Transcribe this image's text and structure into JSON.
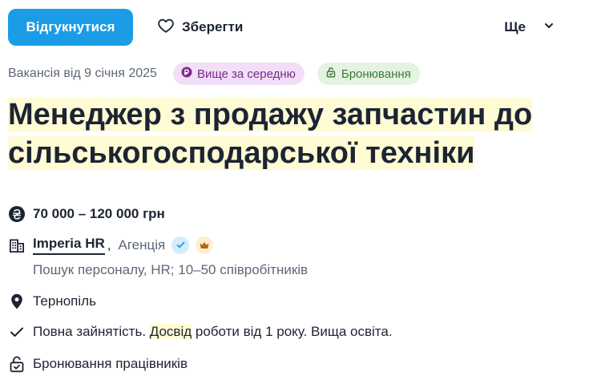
{
  "actions": {
    "apply_label": "Відгукнутися",
    "save_label": "Зберегти",
    "more_label": "Ще"
  },
  "meta": {
    "date": "Вакансія від 9 січня 2025",
    "badge_salary": "Вище за середню",
    "badge_reserve": "Бронювання"
  },
  "vacancy": {
    "title_line1": "Менеджер з продажу запчастин до",
    "title_line2": "сільськогосподарської техніки"
  },
  "details": {
    "salary": "70 000 – 120 000 грн",
    "company_name": "Imperia HR",
    "company_sep": ",",
    "company_type": "Агенція",
    "company_desc": "Пошук персоналу, HR; 10–50 співробітників",
    "location": "Тернопіль",
    "employment_before": "Повна зайнятість. ",
    "employment_highlight": "Досвід",
    "employment_after": " роботи від 1 року. Вища освіта.",
    "booking": "Бронювання працівників"
  },
  "colors": {
    "accent": "#1a9ce6",
    "highlight": "#fffbd4",
    "badge_salary_bg": "#f3def8",
    "badge_reserve_bg": "#e4f3e2"
  },
  "icons": {
    "save": "heart-icon",
    "more": "chevron-down-icon",
    "badge_salary": "coin-icon",
    "badge_reserve": "lock-icon",
    "salary": "hryvnia-icon",
    "company": "building-icon",
    "verified": "check-icon",
    "premium": "crown-icon",
    "location": "map-pin-icon",
    "employment": "check-icon",
    "booking": "lock-icon"
  }
}
